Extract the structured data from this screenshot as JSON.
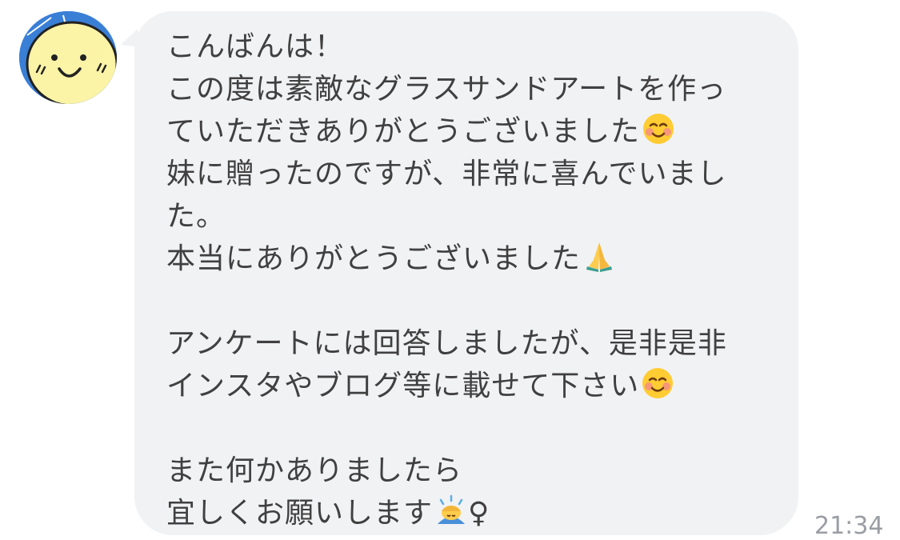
{
  "chat": {
    "sender": {
      "avatar_icon": "smiley-face-avatar-icon"
    },
    "message": {
      "lines": [
        "こんばんは！",
        "この度は素敵なグラスサンドアートを作っ",
        "ていただきありがとうございました",
        "妹に贈ったのですが、非常に喜んでいまし",
        "た。",
        "本当にありがとうございました",
        "",
        "アンケートには回答しましたが、是非是非",
        "インスタやブログ等に載せて下さい",
        "",
        "また何かありましたら",
        "宜しくお願いします"
      ],
      "trailing_emoji": {
        "2": "smiling-face-icon",
        "5": "folded-hands-icon",
        "8": "smiling-face-icon",
        "11": "woman-bowing-icon"
      },
      "trailing_text_after_emoji": {
        "11": "♀"
      }
    },
    "timestamp": "21:34",
    "colors": {
      "bubble_bg": "#f1f2f4",
      "text": "#404040",
      "timestamp": "#9a9da3",
      "avatar_bg": "#3a7fd6",
      "avatar_face": "#fbf3a6"
    }
  }
}
